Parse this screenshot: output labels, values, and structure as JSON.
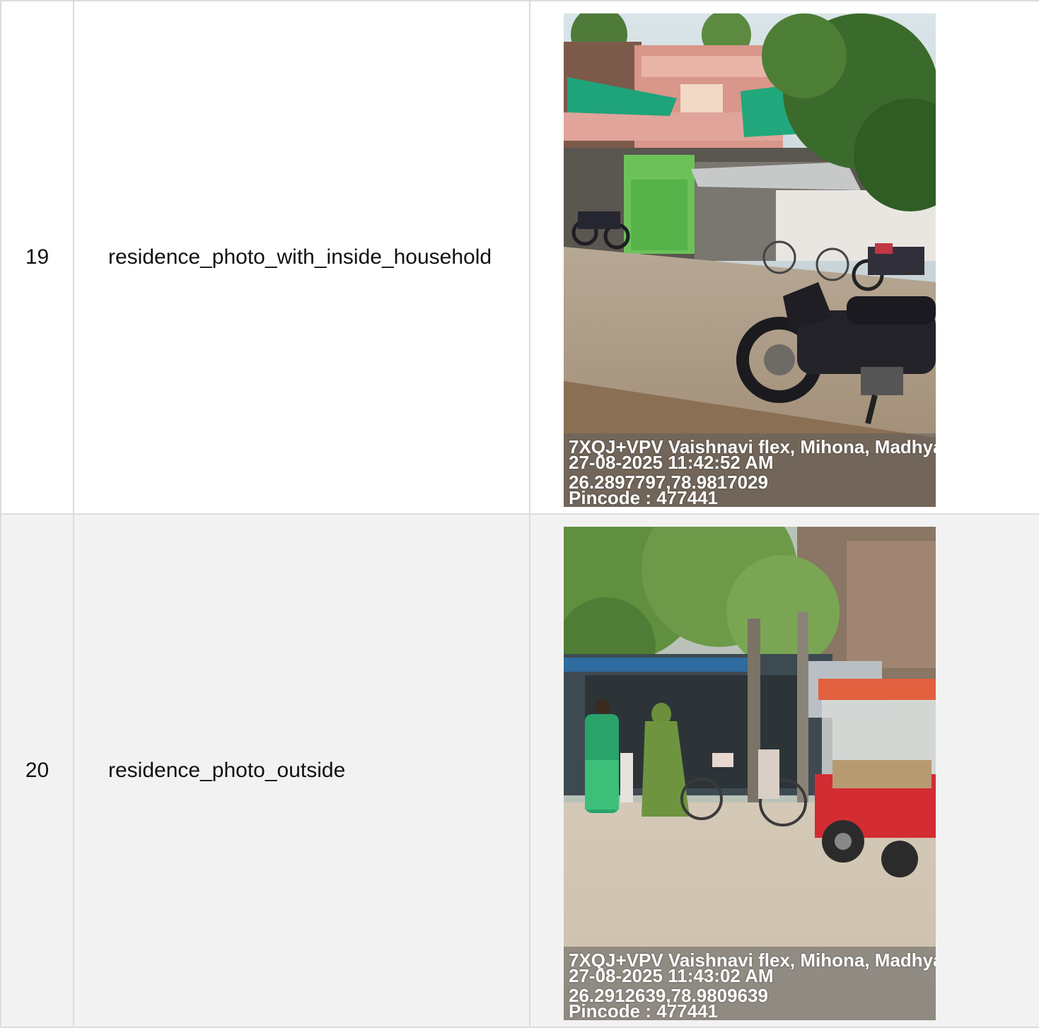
{
  "rows": [
    {
      "number": "19",
      "label": "residence_photo_with_inside_household",
      "photo": {
        "stamp_address": "7XQJ+VPV Vaishnavi flex, Mihona, Madhya",
        "stamp_datetime": "27-08-2025 11:42:52 AM",
        "stamp_coords": "26.2897797,78.9817029",
        "stamp_pincode": "Pincode : 477441"
      }
    },
    {
      "number": "20",
      "label": "residence_photo_outside",
      "photo": {
        "stamp_address": "7XQJ+VPV Vaishnavi flex, Mihona, Madhya",
        "stamp_datetime": "27-08-2025 11:43:02 AM",
        "stamp_coords": "26.2912639,78.9809639",
        "stamp_pincode": "Pincode : 477441"
      }
    }
  ]
}
